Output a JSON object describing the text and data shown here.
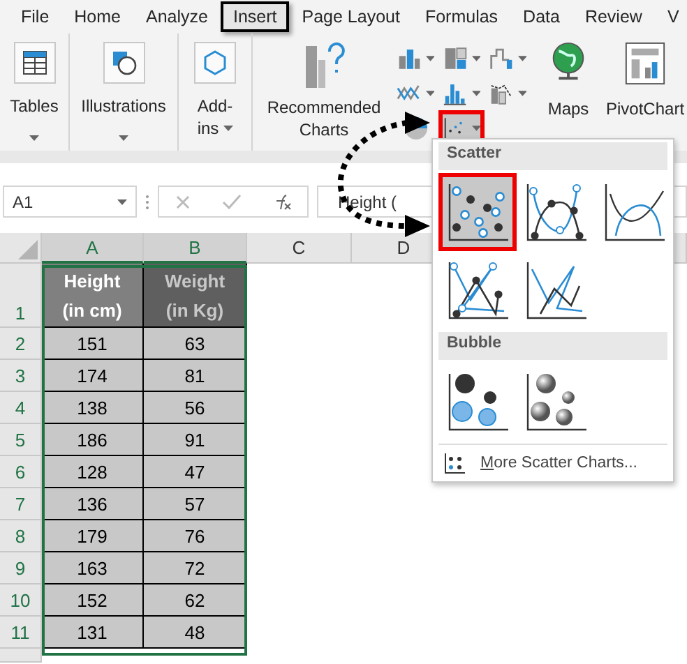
{
  "menu_tabs": [
    {
      "label": "File",
      "selected": false
    },
    {
      "label": "Home",
      "selected": false
    },
    {
      "label": "Analyze",
      "selected": false
    },
    {
      "label": "Insert",
      "selected": true
    },
    {
      "label": "Page Layout",
      "selected": false
    },
    {
      "label": "Formulas",
      "selected": false
    },
    {
      "label": "Data",
      "selected": false
    },
    {
      "label": "Review",
      "selected": false
    },
    {
      "label": "V",
      "selected": false
    }
  ],
  "ribbon": {
    "groups": [
      {
        "kind": "tables",
        "label": "Tables"
      },
      {
        "kind": "illustrations",
        "label": "Illustrations"
      },
      {
        "kind": "addins",
        "label": "Add-",
        "label_2": "ins"
      }
    ],
    "recommended": {
      "label": "Recommended",
      "label_2": "Charts"
    },
    "chart_buttons": [
      {
        "kind": "column",
        "selected": false
      },
      {
        "kind": "hierarchy",
        "selected": false
      },
      {
        "kind": "waterfall",
        "selected": false
      },
      {
        "kind": "line",
        "selected": false
      },
      {
        "kind": "statistic",
        "selected": false
      },
      {
        "kind": "combo",
        "selected": false
      },
      {
        "kind": "pie",
        "selected": false
      },
      {
        "kind": "scatter",
        "selected": true
      }
    ],
    "maps": {
      "label": "Maps"
    },
    "pivotchart": {
      "label": "PivotChart"
    }
  },
  "formula_bar": {
    "name_box": "A1",
    "value": "Height ("
  },
  "sheet": {
    "columns": [
      "A",
      "B",
      "C",
      "D"
    ],
    "header_row": {
      "number": "1",
      "cells": [
        {
          "line_1": "Height",
          "line_2": "(in cm)"
        },
        {
          "line_1": "Weight",
          "line_2": "(in Kg)"
        }
      ]
    },
    "rows": [
      {
        "number": "2",
        "cells": [
          "151",
          "63"
        ]
      },
      {
        "number": "3",
        "cells": [
          "174",
          "81"
        ]
      },
      {
        "number": "4",
        "cells": [
          "138",
          "56"
        ]
      },
      {
        "number": "5",
        "cells": [
          "186",
          "91"
        ]
      },
      {
        "number": "6",
        "cells": [
          "128",
          "47"
        ]
      },
      {
        "number": "7",
        "cells": [
          "136",
          "57"
        ]
      },
      {
        "number": "8",
        "cells": [
          "179",
          "76"
        ]
      },
      {
        "number": "9",
        "cells": [
          "163",
          "72"
        ]
      },
      {
        "number": "10",
        "cells": [
          "152",
          "62"
        ]
      },
      {
        "number": "11",
        "cells": [
          "131",
          "48"
        ]
      }
    ]
  },
  "dropdown": {
    "sections": [
      {
        "title": "Scatter",
        "charts": [
          {
            "kind": "scatter-markers",
            "selected": true
          },
          {
            "kind": "smooth-markers",
            "selected": false
          },
          {
            "kind": "smooth",
            "selected": false
          },
          {
            "kind": "straight-markers",
            "selected": false
          },
          {
            "kind": "straight",
            "selected": false
          }
        ]
      },
      {
        "title": "Bubble",
        "charts": [
          {
            "kind": "bubble",
            "selected": false
          },
          {
            "kind": "bubble-3d",
            "selected": false
          }
        ]
      }
    ],
    "more_link": "More Scatter Charts..."
  }
}
